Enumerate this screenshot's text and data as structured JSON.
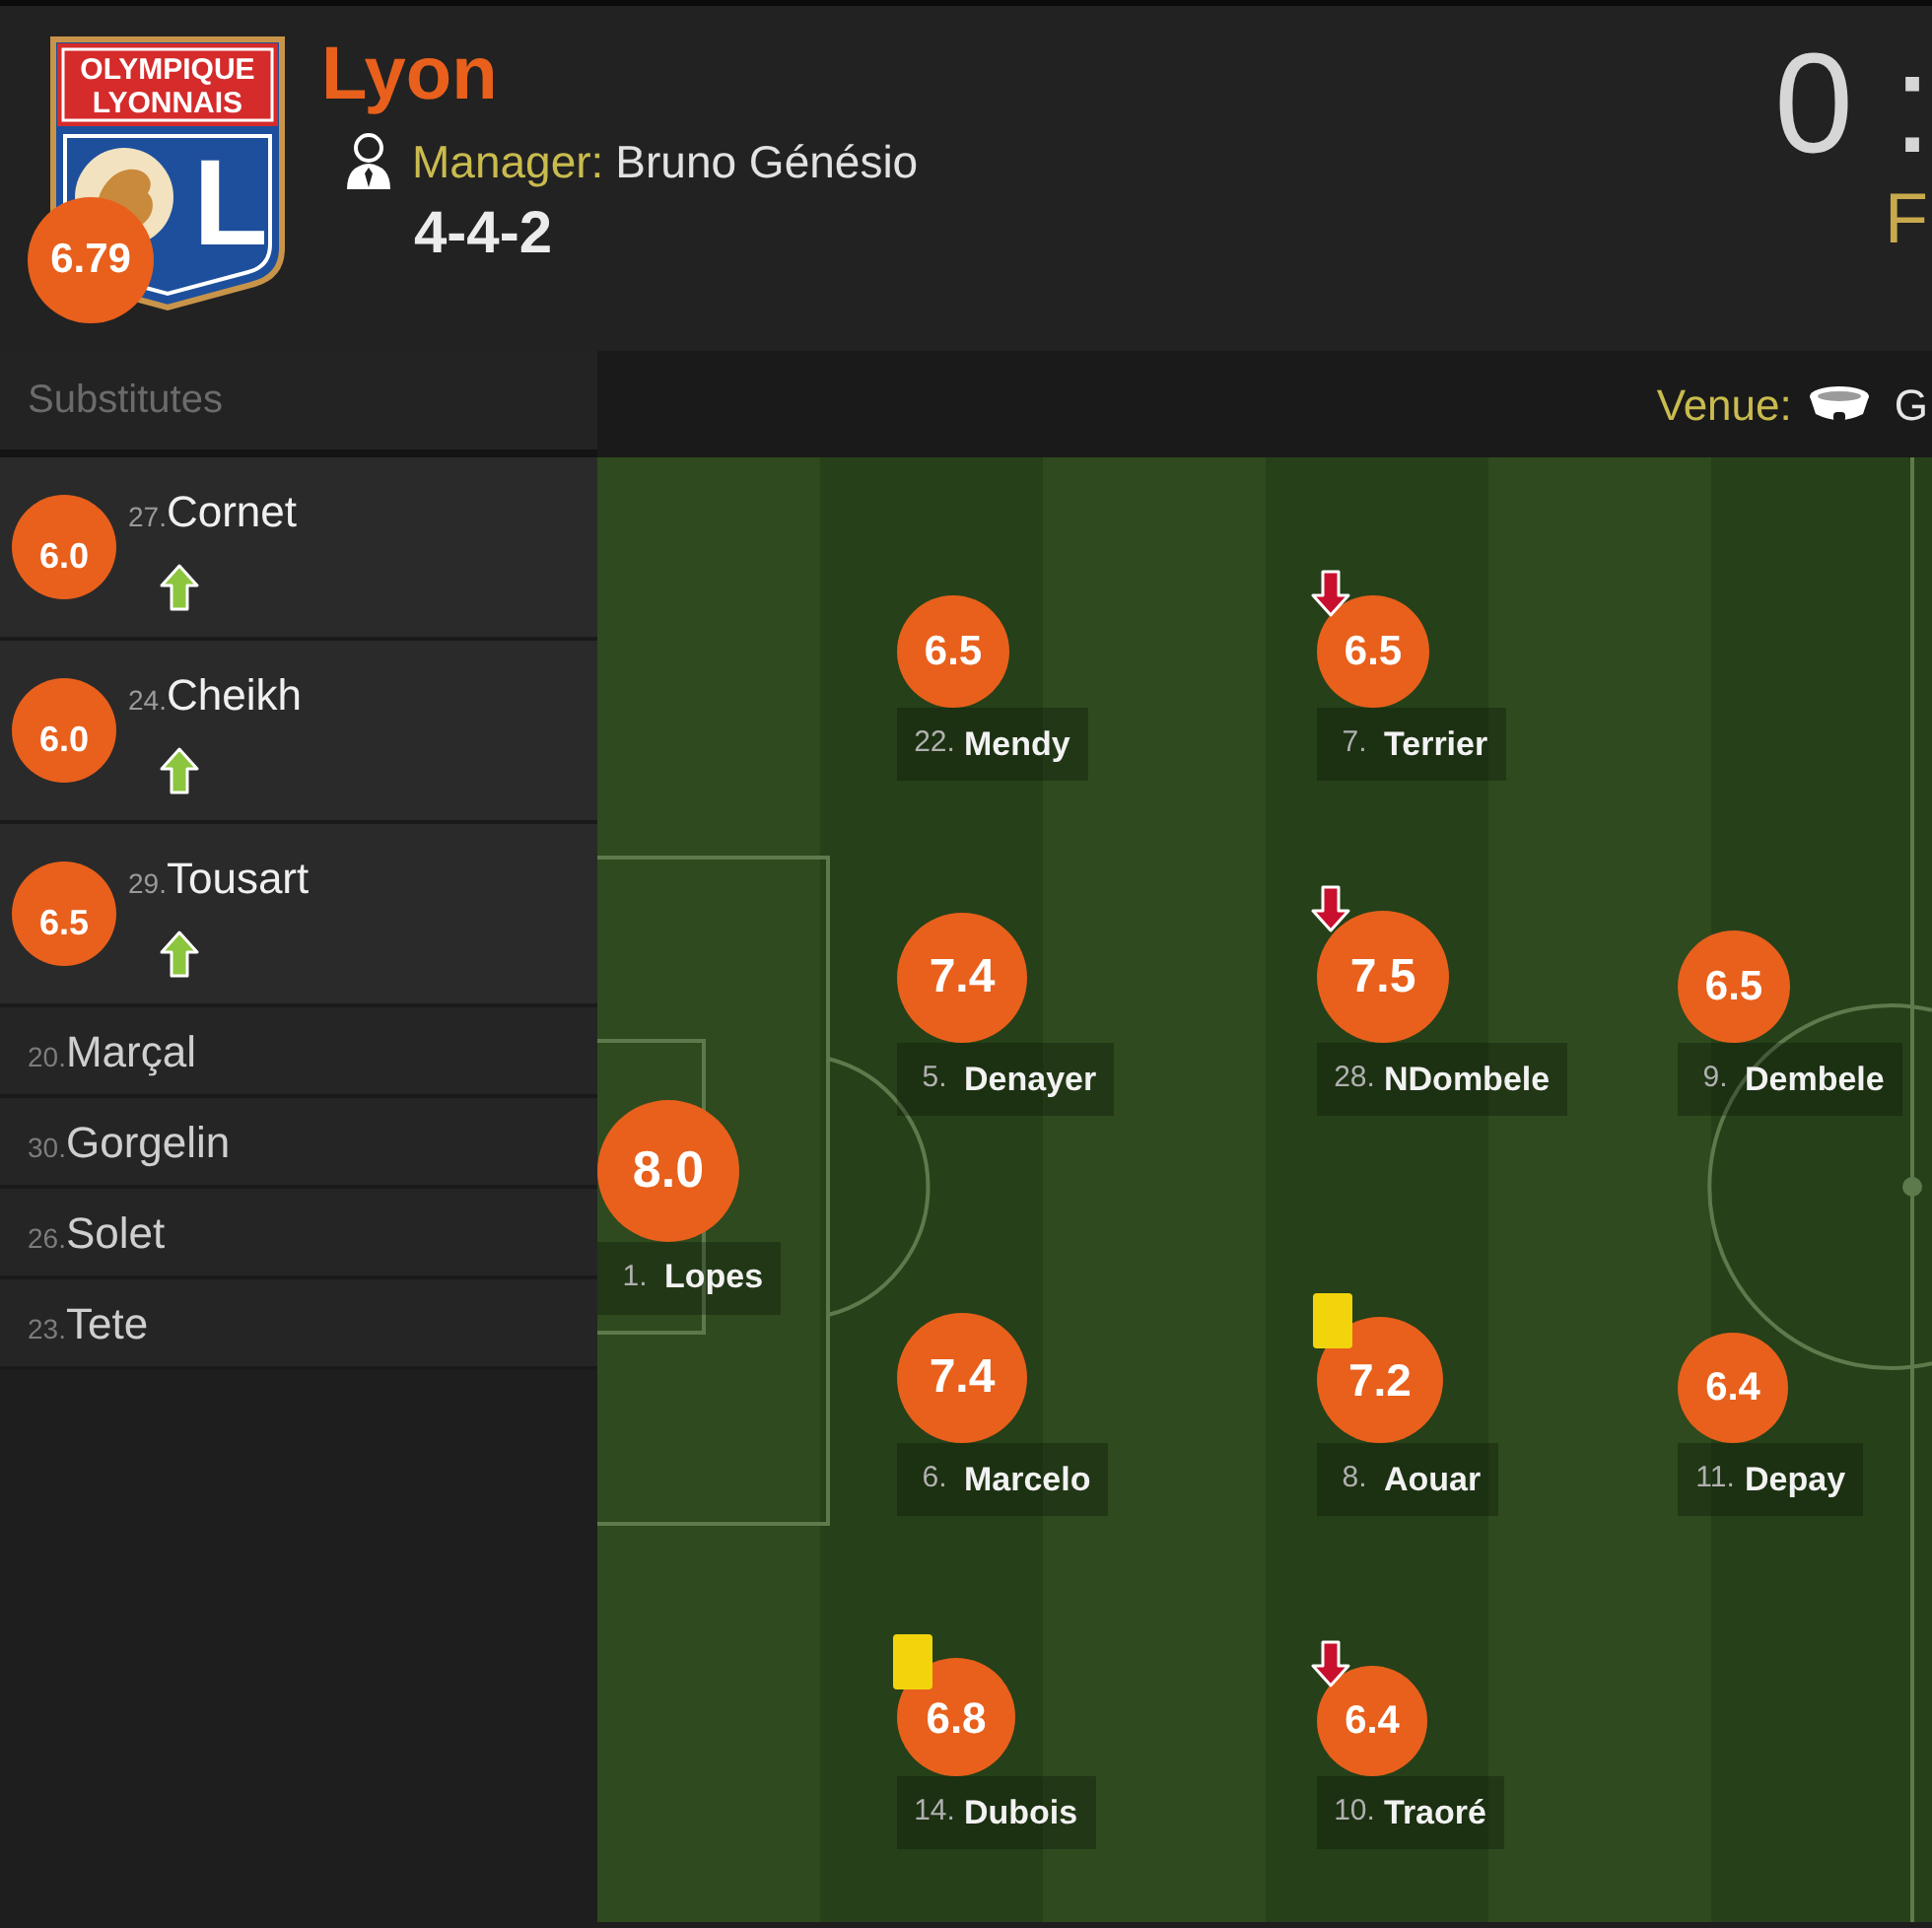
{
  "team": {
    "crest_lines": [
      "OLYMPIQUE",
      "LYONNAIS"
    ],
    "crest_letter": "L",
    "rating": "6.79",
    "name": "Lyon",
    "manager_label": "Manager:",
    "manager": "Bruno Génésio",
    "formation": "4-4-2"
  },
  "score": {
    "value": "0 :",
    "status": "F"
  },
  "substitutes": {
    "title": "Substitutes",
    "players": [
      {
        "kind": "played",
        "rating": "6.0",
        "number": "27.",
        "name": "Cornet",
        "subbed_on": true
      },
      {
        "kind": "played",
        "rating": "6.0",
        "number": "24.",
        "name": "Cheikh",
        "subbed_on": true
      },
      {
        "kind": "played",
        "rating": "6.5",
        "number": "29.",
        "name": "Tousart",
        "subbed_on": true
      },
      {
        "kind": "unused",
        "number": "20.",
        "name": "Marçal",
        "subbed_on": false
      },
      {
        "kind": "unused",
        "number": "30.",
        "name": "Gorgelin",
        "subbed_on": false
      },
      {
        "kind": "unused",
        "number": "26.",
        "name": "Solet",
        "subbed_on": false
      },
      {
        "kind": "unused",
        "number": "23.",
        "name": "Tete",
        "subbed_on": false
      }
    ]
  },
  "venue": {
    "label": "Venue:",
    "value": "G"
  },
  "pitch": {
    "lines": [
      {
        "players": [
          {
            "rating": "8.0",
            "number": "1.",
            "name": "Lopes",
            "yellow_card": false,
            "subbed_off": false
          }
        ]
      },
      {
        "players": [
          {
            "rating": "6.5",
            "number": "22.",
            "name": "Mendy",
            "yellow_card": false,
            "subbed_off": false
          },
          {
            "rating": "7.4",
            "number": "5.",
            "name": "Denayer",
            "yellow_card": false,
            "subbed_off": false
          },
          {
            "rating": "7.4",
            "number": "6.",
            "name": "Marcelo",
            "yellow_card": false,
            "subbed_off": false
          },
          {
            "rating": "6.8",
            "number": "14.",
            "name": "Dubois",
            "yellow_card": true,
            "subbed_off": false
          }
        ]
      },
      {
        "players": [
          {
            "rating": "6.5",
            "number": "7.",
            "name": "Terrier",
            "yellow_card": false,
            "subbed_off": true
          },
          {
            "rating": "7.5",
            "number": "28.",
            "name": "NDombele",
            "yellow_card": false,
            "subbed_off": true
          },
          {
            "rating": "7.2",
            "number": "8.",
            "name": "Aouar",
            "yellow_card": true,
            "subbed_off": false
          },
          {
            "rating": "6.4",
            "number": "10.",
            "name": "Traoré",
            "yellow_card": false,
            "subbed_off": true
          }
        ]
      },
      {
        "players": [
          {
            "rating": "6.5",
            "number": "9.",
            "name": "Dembele",
            "yellow_card": false,
            "subbed_off": false
          },
          {
            "rating": "6.4",
            "number": "11.",
            "name": "Depay",
            "yellow_card": false,
            "subbed_off": false
          }
        ]
      }
    ]
  }
}
